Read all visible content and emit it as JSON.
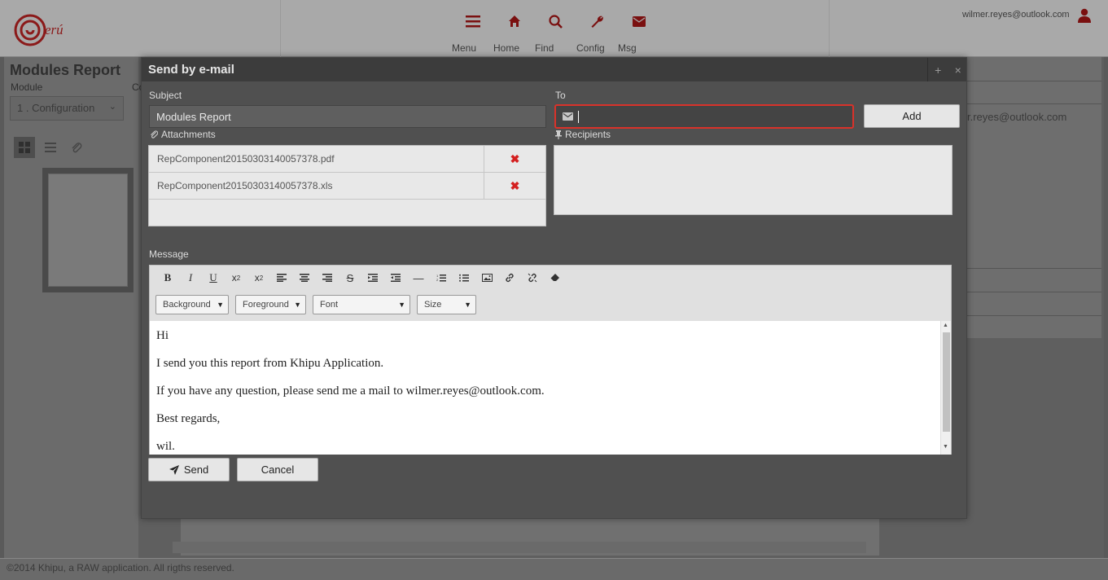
{
  "app": {
    "nav": [
      {
        "label": "Menu",
        "icon": "menu-icon"
      },
      {
        "label": "Home",
        "icon": "home-icon"
      },
      {
        "label": "Find",
        "icon": "search-icon"
      },
      {
        "label": "Config",
        "icon": "wrench-icon"
      },
      {
        "label": "Msg",
        "icon": "envelope-icon"
      }
    ],
    "user_email": "wilmer.reyes@outlook.com",
    "accent": "#8b1a1a"
  },
  "background": {
    "page_title": "Modules Report",
    "module_label": "Module",
    "module_label2": "Co",
    "module_selected": "1 . Configuration",
    "right_email": "r.reyes@outlook.com",
    "footer": "©2014 Khipu, a RAW application. All rigths reserved."
  },
  "modal": {
    "title": "Send by e-mail",
    "subject_label": "Subject",
    "subject_value": "Modules Report",
    "to_label": "To",
    "to_value": "",
    "add_label": "Add",
    "attachments_label": "Attachments",
    "attachments": [
      "RepComponent20150303140057378.pdf",
      "RepComponent20150303140057378.xls"
    ],
    "recipients_label": "Recipients",
    "message_label": "Message",
    "toolbar_selects": [
      "Background",
      "Foreground",
      "Font",
      "Size"
    ],
    "message_lines": [
      "Hi",
      "I send you this report from Khipu Application.",
      "If you have any question, please send me a mail to wilmer.reyes@outlook.com.",
      "Best regards,",
      "wil."
    ],
    "send_label": "Send",
    "cancel_label": "Cancel"
  }
}
